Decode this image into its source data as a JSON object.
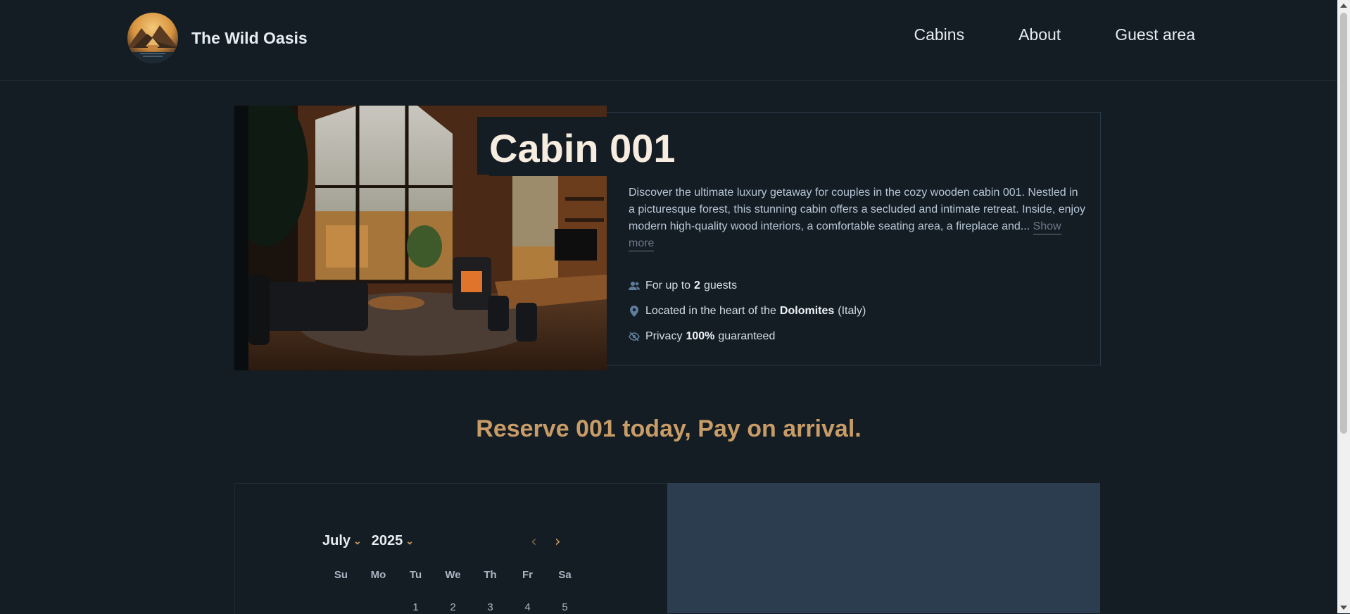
{
  "brand": {
    "name": "The Wild Oasis"
  },
  "nav": {
    "items": [
      {
        "label": "Cabins"
      },
      {
        "label": "About"
      },
      {
        "label": "Guest area"
      }
    ]
  },
  "cabin": {
    "title": "Cabin 001",
    "description": "Discover the ultimate luxury getaway for couples in the cozy wooden cabin 001. Nestled in a picturesque forest, this stunning cabin offers a secluded and intimate retreat. Inside, enjoy modern high-quality wood interiors, a comfortable seating area, a fireplace and...",
    "show_more": "Show more",
    "features": {
      "guests": {
        "prefix": "For up to",
        "value": "2",
        "suffix": "guests",
        "icon": "users-icon"
      },
      "location": {
        "prefix": "Located in the heart of the",
        "value": "Dolomites",
        "suffix": "(Italy)",
        "icon": "map-pin-icon"
      },
      "privacy": {
        "prefix": "Privacy",
        "value": "100%",
        "suffix": "guaranteed",
        "icon": "eye-slash-icon"
      }
    }
  },
  "reserve": {
    "heading": "Reserve 001 today, Pay on arrival."
  },
  "calendar": {
    "month": "July",
    "year": "2025",
    "weekdays": [
      "Su",
      "Mo",
      "Tu",
      "We",
      "Th",
      "Fr",
      "Sa"
    ],
    "first_row": [
      "",
      "",
      "1",
      "2",
      "3",
      "4",
      "5"
    ]
  },
  "colors": {
    "background": "#141c24",
    "accent": "#c89c67",
    "panel": "#2c3d50"
  }
}
